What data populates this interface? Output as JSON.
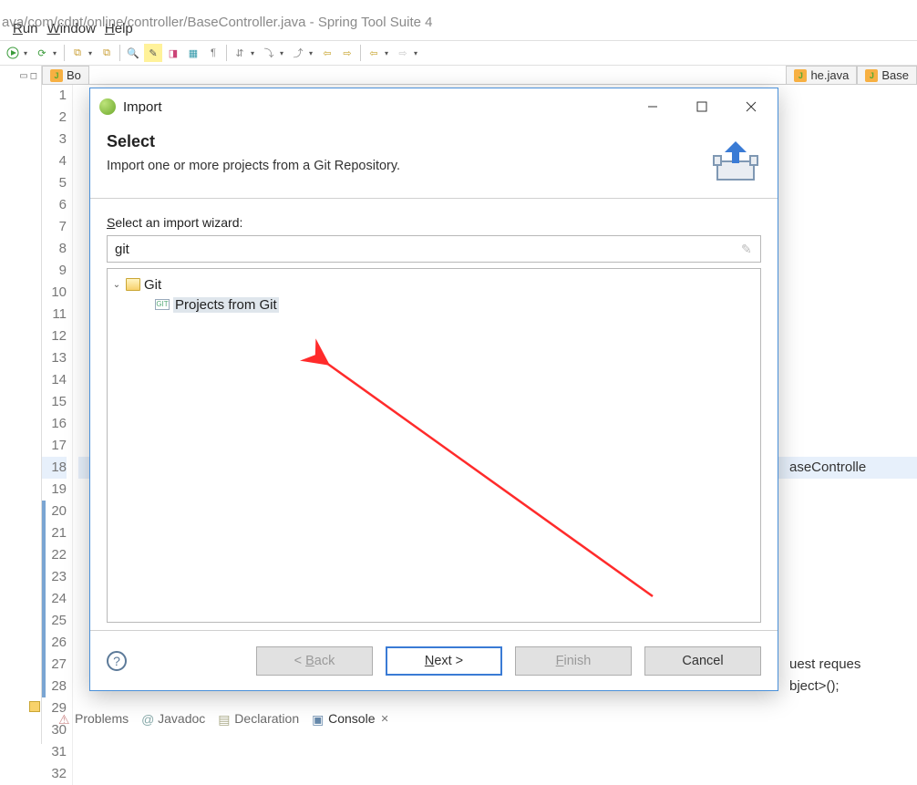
{
  "window_title_fragment": "ava/com/cdnt/online/controller/BaseController.java - Spring Tool Suite 4",
  "menubar": {
    "run": "Run",
    "window": "Window",
    "help": "Help"
  },
  "editor_tabs": {
    "left": "Bo",
    "right1": "he.java",
    "right2": "Base"
  },
  "gutter": {
    "start": 1,
    "end": 32
  },
  "code": {
    "l18": "aseControlle",
    "l27": "uest reques",
    "l28": "bject>();"
  },
  "bottom": {
    "problems": "Problems",
    "javadoc": "Javadoc",
    "declaration": "Declaration",
    "console": "Console"
  },
  "dialog": {
    "title": "Import",
    "heading": "Select",
    "subheading": "Import one or more projects from a Git Repository.",
    "wizard_label": "Select an import wizard:",
    "filter_value": "git",
    "tree": {
      "cat": "Git",
      "item": "Projects from Git"
    },
    "buttons": {
      "back": "< Back",
      "next": "Next >",
      "finish": "Finish",
      "cancel": "Cancel"
    }
  }
}
